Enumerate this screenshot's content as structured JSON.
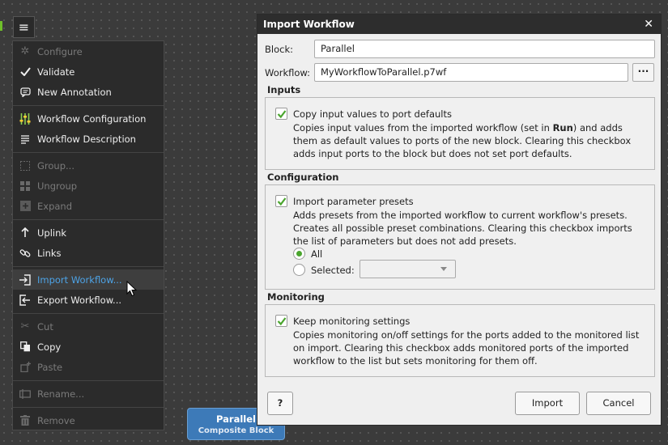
{
  "menu_button": {
    "icon": "hamburger-icon",
    "glyph": "≡"
  },
  "context_menu": {
    "items": [
      {
        "label": "Configure",
        "icon": "gear-icon",
        "enabled": false
      },
      {
        "label": "Validate",
        "icon": "checkmark-icon",
        "enabled": true
      },
      {
        "label": "New Annotation",
        "icon": "annotation-icon",
        "enabled": true
      },
      {
        "label": "Workflow Configuration",
        "icon": "sliders-icon",
        "enabled": true
      },
      {
        "label": "Workflow Description",
        "icon": "description-icon",
        "enabled": true
      },
      {
        "label": "Group...",
        "icon": "group-icon",
        "enabled": false
      },
      {
        "label": "Ungroup",
        "icon": "ungroup-icon",
        "enabled": false
      },
      {
        "label": "Expand",
        "icon": "expand-icon",
        "enabled": false
      },
      {
        "label": "Uplink",
        "icon": "uplink-arrow-icon",
        "enabled": true
      },
      {
        "label": "Links",
        "icon": "link-icon",
        "enabled": true
      },
      {
        "label": "Import Workflow...",
        "icon": "import-icon",
        "enabled": true,
        "highlighted": true
      },
      {
        "label": "Export Workflow...",
        "icon": "export-icon",
        "enabled": true
      },
      {
        "label": "Cut",
        "icon": "scissors-icon",
        "enabled": false
      },
      {
        "label": "Copy",
        "icon": "copy-icon",
        "enabled": true
      },
      {
        "label": "Paste",
        "icon": "paste-icon",
        "enabled": false
      },
      {
        "label": "Rename...",
        "icon": "rename-icon",
        "enabled": false
      },
      {
        "label": "Remove",
        "icon": "trash-icon",
        "enabled": false
      }
    ]
  },
  "block": {
    "name": "Parallel",
    "type": "Composite Block"
  },
  "dialog": {
    "title": "Import Workflow",
    "block_label": "Block:",
    "block_value": "Parallel",
    "workflow_label": "Workflow:",
    "workflow_value": "MyWorkflowToParallel.p7wf",
    "browse_label": "···",
    "inputs": {
      "title": "Inputs",
      "checkbox_label": "Copy input values to port defaults",
      "checked": true,
      "desc_pre": "Copies input values from the imported workflow (set in ",
      "desc_bold": "Run",
      "desc_post": ") and adds them as default values to ports of the new block. Clearing this checkbox adds input ports to the block but does not set port defaults."
    },
    "configuration": {
      "title": "Configuration",
      "checkbox_label": "Import parameter presets",
      "checked": true,
      "desc": "Adds presets from the imported workflow to current workflow's presets. Creates all possible preset combinations. Clearing this checkbox imports the list of parameters but does not add presets.",
      "radio_all": "All",
      "radio_selected": "Selected:",
      "selected_option": "all"
    },
    "monitoring": {
      "title": "Monitoring",
      "checkbox_label": "Keep monitoring settings",
      "checked": true,
      "desc": "Copies monitoring on/off settings for the ports added to the monitored list on import. Clearing this checkbox adds monitored ports of the imported workflow to the list but sets monitoring for them off."
    },
    "help_label": "?",
    "import_label": "Import",
    "cancel_label": "Cancel"
  },
  "colors": {
    "accent_green": "#4aa52e",
    "highlight_blue": "#4da3e6",
    "block_blue": "#3d7ab8"
  }
}
